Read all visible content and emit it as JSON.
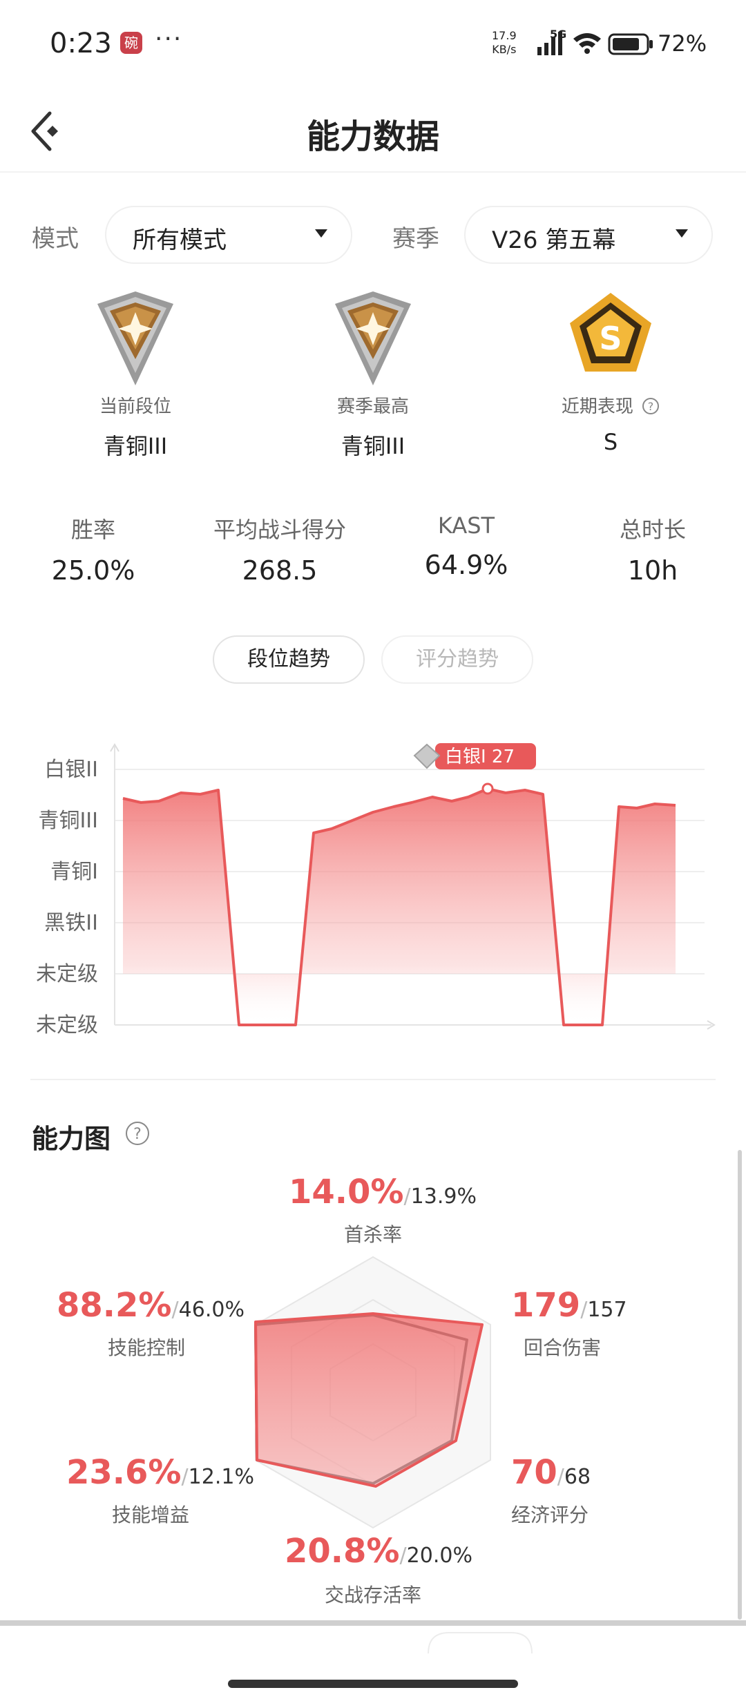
{
  "status_bar": {
    "time": "0:23",
    "app_badge": "碗",
    "more": "···",
    "speed_value": "17.9",
    "speed_unit": "KB/s",
    "network": "5G",
    "battery": "72%"
  },
  "header": {
    "title": "能力数据",
    "back_icon": "back-chevron-icon"
  },
  "filters": {
    "mode_label": "模式",
    "mode_value": "所有模式",
    "season_label": "赛季",
    "season_value": "V26 第五幕"
  },
  "ranks": [
    {
      "label": "当前段位",
      "value": "青铜III",
      "icon": "bronze-rank-icon"
    },
    {
      "label": "赛季最高",
      "value": "青铜III",
      "icon": "bronze-rank-icon"
    },
    {
      "label": "近期表现",
      "value": "S",
      "icon": "s-grade-icon",
      "help": "help-icon"
    }
  ],
  "stats": [
    {
      "label": "胜率",
      "value": "25.0%"
    },
    {
      "label": "平均战斗得分",
      "value": "268.5"
    },
    {
      "label": "KAST",
      "value": "64.9%"
    },
    {
      "label": "总时长",
      "value": "10h"
    }
  ],
  "tabs": [
    {
      "label": "段位趋势",
      "active": true
    },
    {
      "label": "评分趋势",
      "active": false
    }
  ],
  "trend": {
    "y_levels": [
      "白银II",
      "青铜III",
      "青铜I",
      "黑铁II",
      "未定级",
      "未定级"
    ],
    "tooltip": "白银I 27",
    "accent": "#e8595a"
  },
  "ability": {
    "title": "能力图",
    "metrics": [
      {
        "label": "首杀率",
        "value": "14.0%",
        "avg": "13.9%"
      },
      {
        "label": "回合伤害",
        "value": "179",
        "avg": "157"
      },
      {
        "label": "经济评分",
        "value": "70",
        "avg": "68"
      },
      {
        "label": "交战存活率",
        "value": "20.8%",
        "avg": "20.0%"
      },
      {
        "label": "技能增益",
        "value": "23.6%",
        "avg": "12.1%"
      },
      {
        "label": "技能控制",
        "value": "88.2%",
        "avg": "46.0%"
      }
    ]
  }
}
